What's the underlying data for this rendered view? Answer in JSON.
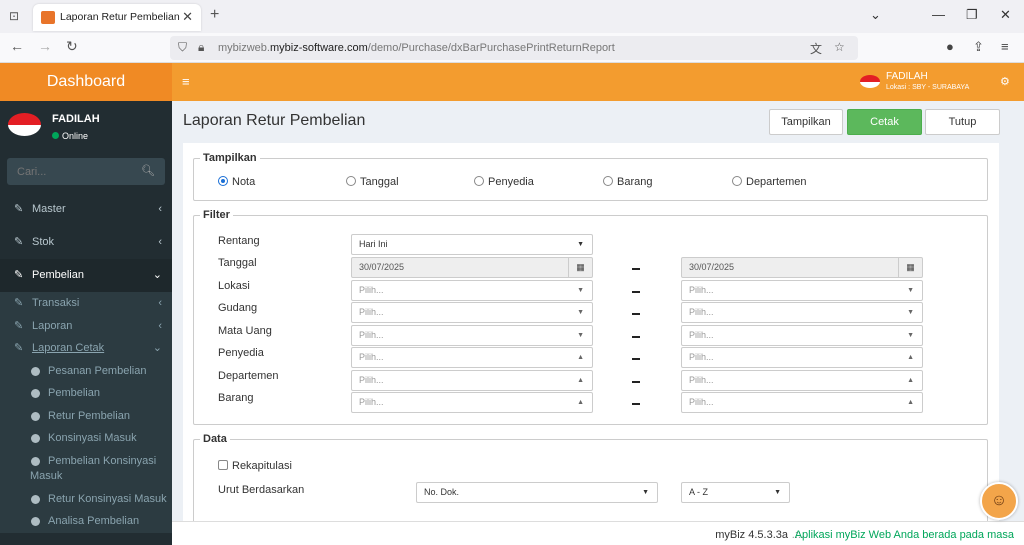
{
  "browser": {
    "tab_title": "Laporan Retur Pembelian",
    "url_prefix": "mybizweb.",
    "url_domain": "mybiz-software.com",
    "url_path": "/demo/Purchase/dxBarPurchasePrintReturnReport"
  },
  "sidebar": {
    "logo": "Dashboard",
    "user_name": "FADILAH",
    "user_status": "Online",
    "search_placeholder": "Cari...",
    "menu": [
      {
        "label": "Master"
      },
      {
        "label": "Stok"
      },
      {
        "label": "Pembelian"
      }
    ],
    "submenu": [
      {
        "label": "Transaksi"
      },
      {
        "label": "Laporan"
      },
      {
        "label": "Laporan Cetak"
      }
    ],
    "report_items": [
      {
        "label": "Pesanan Pembelian"
      },
      {
        "label": "Pembelian"
      },
      {
        "label": "Retur Pembelian"
      },
      {
        "label": "Konsinyasi Masuk"
      },
      {
        "label1": "Pembelian Konsinyasi",
        "label2": "Masuk"
      },
      {
        "label": "Retur Konsinyasi Masuk"
      },
      {
        "label": "Analisa Pembelian"
      }
    ]
  },
  "topbar": {
    "user_name": "FADILAH",
    "location": "Lokasi : SBY - SURABAYA"
  },
  "page": {
    "title": "Laporan Retur Pembelian",
    "btn_show": "Tampilkan",
    "btn_print": "Cetak",
    "btn_close": "Tutup"
  },
  "tampilkan": {
    "legend": "Tampilkan",
    "options": [
      "Nota",
      "Tanggal",
      "Penyedia",
      "Barang",
      "Departemen"
    ],
    "selected": "Nota"
  },
  "filter": {
    "legend": "Filter",
    "labels": [
      "Rentang",
      "Tanggal",
      "Lokasi",
      "Gudang",
      "Mata Uang",
      "Penyedia",
      "Departemen",
      "Barang"
    ],
    "range_value": "Hari Ini",
    "date_from": "30/07/2025",
    "date_to": "30/07/2025",
    "placeholder": "Pilih..."
  },
  "data": {
    "legend": "Data",
    "recap_label": "Rekapitulasi",
    "sort_label": "Urut Berdasarkan",
    "sort_field": "No. Dok.",
    "sort_order": "A - Z"
  },
  "footer": {
    "version": "myBiz 4.5.3.3a",
    "separator": ".::.",
    "message": "Aplikasi myBiz Web Anda berada pada masa"
  }
}
